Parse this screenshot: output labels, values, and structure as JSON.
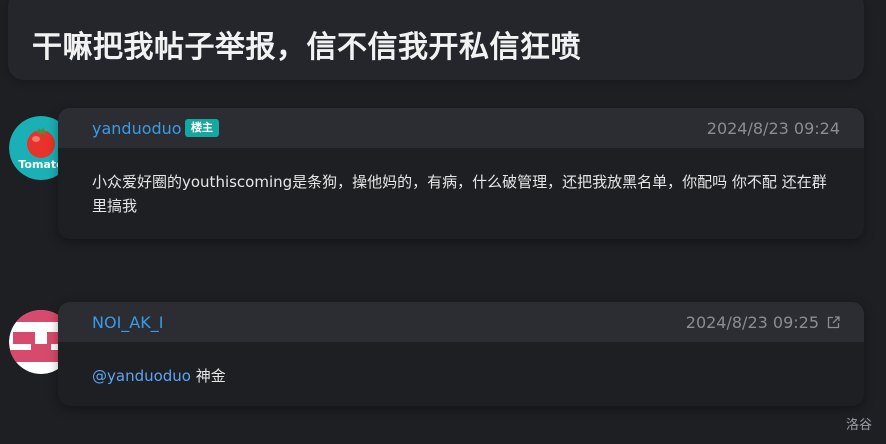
{
  "post": {
    "title": "干嘛把我帖子举报，信不信我开私信狂喷"
  },
  "replies": [
    {
      "username": "yanduoduo",
      "badge": "楼主",
      "timestamp": "2024/8/23 09:24",
      "avatar": {
        "icon": "tomato-icon",
        "label": "Tomato",
        "bg_color": "#1ab0b5"
      },
      "content": "小众爱好圈的youthiscoming是条狗，操他妈的，有病，什么破管理，还把我放黑名单，你配吗 你不配 还在群里搞我"
    },
    {
      "username": "NOI_AK_I",
      "timestamp": "2024/8/23 09:25",
      "avatar": {
        "icon": "identicon-icon",
        "color": "#d64b6b"
      },
      "mention": "@yanduoduo",
      "content": " 神金",
      "link_icon": "external-link-icon"
    }
  ],
  "footer": {
    "label": "洛谷"
  },
  "colors": {
    "background": "#1e1f23",
    "card_header": "#2b2d32",
    "username": "#3b9ae6",
    "badge": "#14a8a0",
    "mention": "#5ea4f5"
  }
}
